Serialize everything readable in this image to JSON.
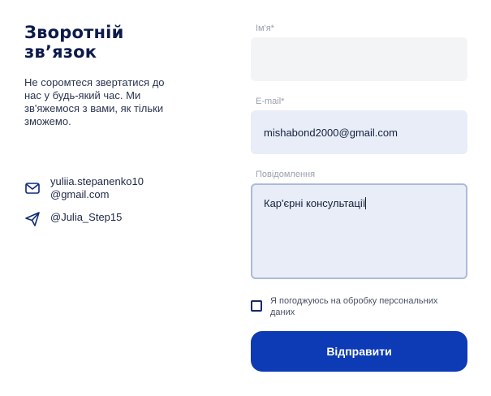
{
  "left": {
    "title_line1": "Зворотній",
    "title_line2": "зв’язок",
    "subtitle": "Не соромтеся звертатися до нас у будь-який час. Ми зв'яжемося з вами, як тільки зможемо."
  },
  "contacts": {
    "email_line1": "yuliia.stepanenko10",
    "email_line2": "@gmail.com",
    "telegram": "@Julia_Step15",
    "email_icon": "mail-icon",
    "telegram_icon": "send-icon"
  },
  "form": {
    "name_label": "Ім'я*",
    "name_value": "",
    "email_label": "E-mail*",
    "email_value": "mishabond2000@gmail.com",
    "message_label": "Повідомлення",
    "message_value": "Кар'єрні консультації",
    "consent_text": "Я погоджуюсь на обробку персональних даних",
    "consent_checked": false,
    "submit_label": "Відправити"
  },
  "colors": {
    "primary": "#0d3bb5",
    "title": "#0c1a4b",
    "field_bg": "#f3f4f6",
    "field_filled_bg": "#e8edf8"
  }
}
